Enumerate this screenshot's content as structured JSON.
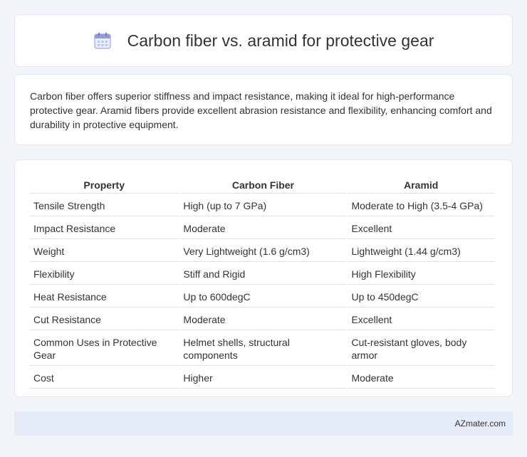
{
  "header": {
    "title": "Carbon fiber vs. aramid for protective gear",
    "icon": "calendar-icon"
  },
  "intro": {
    "text": "Carbon fiber offers superior stiffness and impact resistance, making it ideal for high-performance protective gear. Aramid fibers provide excellent abrasion resistance and flexibility, enhancing comfort and durability in protective equipment."
  },
  "table": {
    "headers": [
      "Property",
      "Carbon Fiber",
      "Aramid"
    ],
    "rows": [
      [
        "Tensile Strength",
        "High (up to 7 GPa)",
        "Moderate to High (3.5-4 GPa)"
      ],
      [
        "Impact Resistance",
        "Moderate",
        "Excellent"
      ],
      [
        "Weight",
        "Very Lightweight (1.6 g/cm3)",
        "Lightweight (1.44 g/cm3)"
      ],
      [
        "Flexibility",
        "Stiff and Rigid",
        "High Flexibility"
      ],
      [
        "Heat Resistance",
        "Up to 600degC",
        "Up to 450degC"
      ],
      [
        "Cut Resistance",
        "Moderate",
        "Excellent"
      ],
      [
        "Common Uses in Protective Gear",
        "Helmet shells, structural components",
        "Cut-resistant gloves, body armor"
      ],
      [
        "Cost",
        "Higher",
        "Moderate"
      ]
    ]
  },
  "footer": {
    "brand": "AZmater.com"
  },
  "colors": {
    "accent": "#7b8fd6",
    "page_background": "#f1f4f9",
    "footer_background": "#e6ecf7"
  }
}
